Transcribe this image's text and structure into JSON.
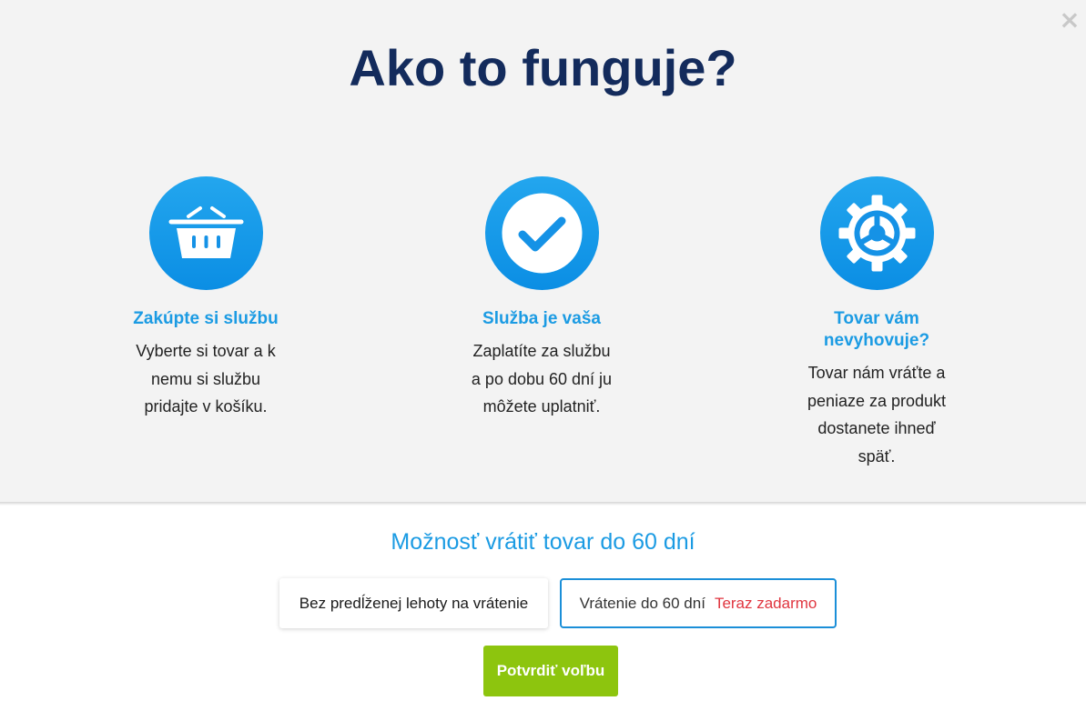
{
  "modal": {
    "close_label": "×",
    "title": "Ako to funguje?"
  },
  "steps": [
    {
      "icon": "basket-icon",
      "title": "Zakúpte si službu",
      "text": "Vyberte si tovar a k nemu si službu pridajte v košíku."
    },
    {
      "icon": "checkmark-icon",
      "title": "Služba je vaša",
      "text": "Zaplatíte za službu a po dobu 60 dní ju môžete uplatniť."
    },
    {
      "icon": "gear-icon",
      "title": "Tovar vám nevyhovuje?",
      "text": "Tovar nám vráťte a peniaze za produkt dostanete ihneď späť."
    }
  ],
  "choice": {
    "title": "Možnosť vrátiť tovar do 60 dní",
    "option_1_label": "Bez predĺženej lehoty na vrátenie",
    "option_2_label": "Vrátenie do 60 dní",
    "option_2_badge": "Teraz zadarmo",
    "confirm_label": "Potvrdiť voľbu"
  },
  "colors": {
    "heading": "#132b5c",
    "accent": "#1b9be3",
    "confirm": "#8dc50e",
    "free_badge": "#e0353f"
  }
}
